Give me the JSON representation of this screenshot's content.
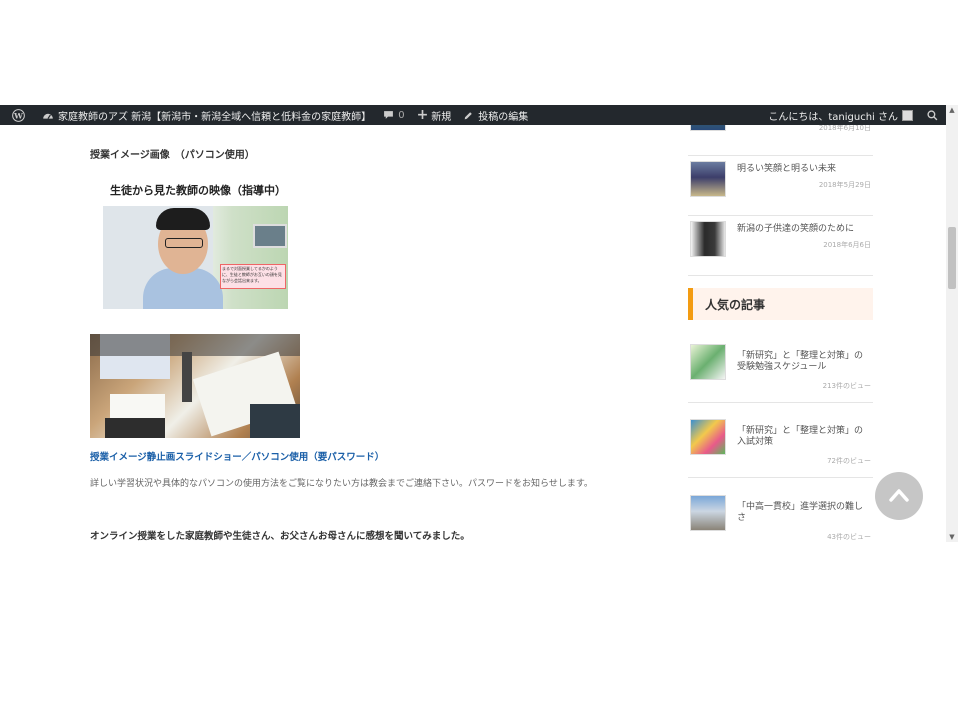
{
  "adminbar": {
    "site_name": "家庭教師のアズ 新潟【新潟市・新潟全域へ信頼と低料金の家庭教師】",
    "comments_count": "0",
    "new_label": "新規",
    "edit_label": "投稿の編集",
    "greeting": "こんにちは、taniguchi さん"
  },
  "main": {
    "heading1": "授業イメージ画像　（パソコン使用）",
    "image1_caption": "生徒から見た教師の映像（指導中）",
    "image1_bubble": "まるで対面授業してるかのように、生徒と教師がお互いの顔を見ながら会話出来ます。",
    "link_label": "授業イメージ静止画スライドショー／パソコン使用（要パスワード）",
    "description": "詳しい学習状況や具体的なパソコンの使用方法をご覧になりたい方は教会までご連絡下さい。パスワードをお知らせします。",
    "bottom_heading": "オンライン授業をした家庭教師や生徒さん、お父さんお母さんに感想を聞いてみました。"
  },
  "sidebar": {
    "recent_posts": [
      {
        "title": "",
        "date": "2018年6月10日"
      },
      {
        "title": "明るい笑顔と明るい未来",
        "date": "2018年5月29日"
      },
      {
        "title": "新潟の子供達の笑顔のために",
        "date": "2018年6月6日"
      }
    ],
    "popular_heading": "人気の記事",
    "popular_posts": [
      {
        "title": "「新研究」と「整理と対策」の受験勉強スケジュール",
        "views": "213件のビュー"
      },
      {
        "title": "「新研究」と「整理と対策」の入試対策",
        "views": "72件のビュー"
      },
      {
        "title": "「中高一貫校」進学選択の難しさ",
        "views": "43件のビュー"
      }
    ]
  },
  "colors": {
    "adminbar_bg": "#23282d",
    "accent_orange": "#f39c12",
    "link_blue": "#1a5fa8"
  }
}
